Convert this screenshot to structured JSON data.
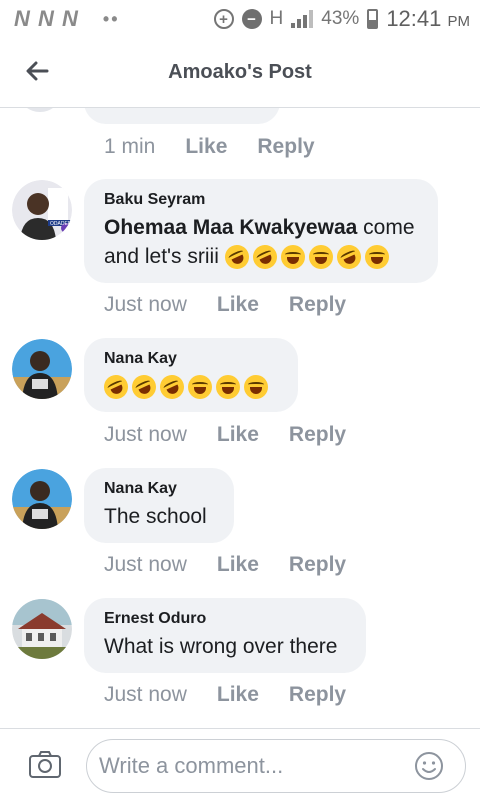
{
  "status_bar": {
    "carrier_glyphs": "N N N",
    "dots": "••",
    "network_type": "H",
    "battery_percent": "43%",
    "battery_level": 0.43,
    "time": "12:41",
    "ampm": "PM"
  },
  "header": {
    "title": "Amoako's Post"
  },
  "top_clipped_comment": {
    "time": "1 min",
    "like_label": "Like",
    "reply_label": "Reply"
  },
  "comments": [
    {
      "author": "Baku Seyram",
      "mention": "Ohemaa Maa Kwakyewaa",
      "text": " come and let's sriii",
      "emoji_count": 6,
      "time": "Just now",
      "like_label": "Like",
      "reply_label": "Reply",
      "avatar_badge": "ODADEE"
    },
    {
      "author": "Nana Kay",
      "text": "",
      "emoji_count": 6,
      "time": "Just now",
      "like_label": "Like",
      "reply_label": "Reply"
    },
    {
      "author": "Nana Kay",
      "text": "The school",
      "time": "Just now",
      "like_label": "Like",
      "reply_label": "Reply"
    },
    {
      "author": "Ernest Oduro",
      "text": "What is wrong over there",
      "time": "Just now",
      "like_label": "Like",
      "reply_label": "Reply"
    }
  ],
  "composer": {
    "placeholder": "Write a comment...",
    "camera_icon": "camera-icon",
    "sticker_icon": "smiley-icon"
  },
  "colors": {
    "bubble": "#f0f2f5",
    "meta_text": "#8d949e",
    "divider": "#dadde1",
    "emoji": "#ffcc33"
  }
}
